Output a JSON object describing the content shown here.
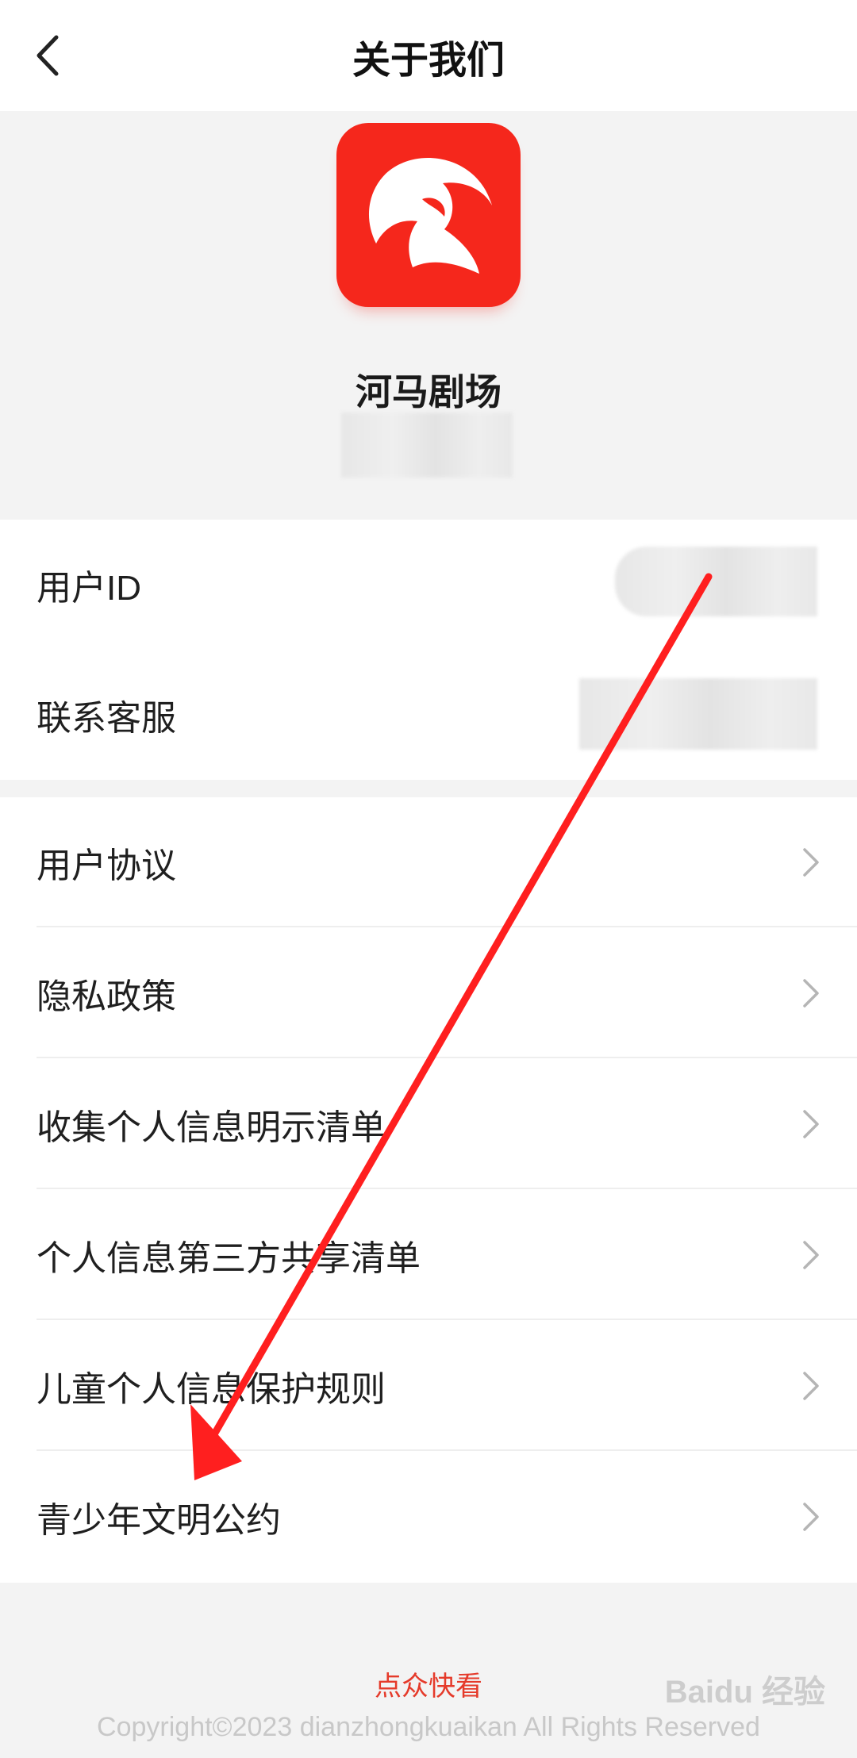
{
  "header": {
    "title": "关于我们",
    "back_icon": "chevron-left-icon"
  },
  "app": {
    "name": "河马剧场",
    "logo_icon": "play-swirl-logo",
    "brand_color": "#f5271c"
  },
  "info_rows": [
    {
      "label": "用户ID"
    },
    {
      "label": "联系客服"
    }
  ],
  "link_rows": [
    {
      "label": "用户协议"
    },
    {
      "label": "隐私政策"
    },
    {
      "label": "收集个人信息明示清单"
    },
    {
      "label": "个人信息第三方共享清单"
    },
    {
      "label": "儿童个人信息保护规则"
    },
    {
      "label": "青少年文明公约"
    }
  ],
  "footer": {
    "brand": "点众快看",
    "copyright": "Copyright©2023 dianzhongkuaikan All Rights Reserved",
    "brand_color": "#e53a2a"
  },
  "watermark": "Baidu 经验",
  "annotation": {
    "type": "arrow",
    "color": "#ff1f1f"
  }
}
